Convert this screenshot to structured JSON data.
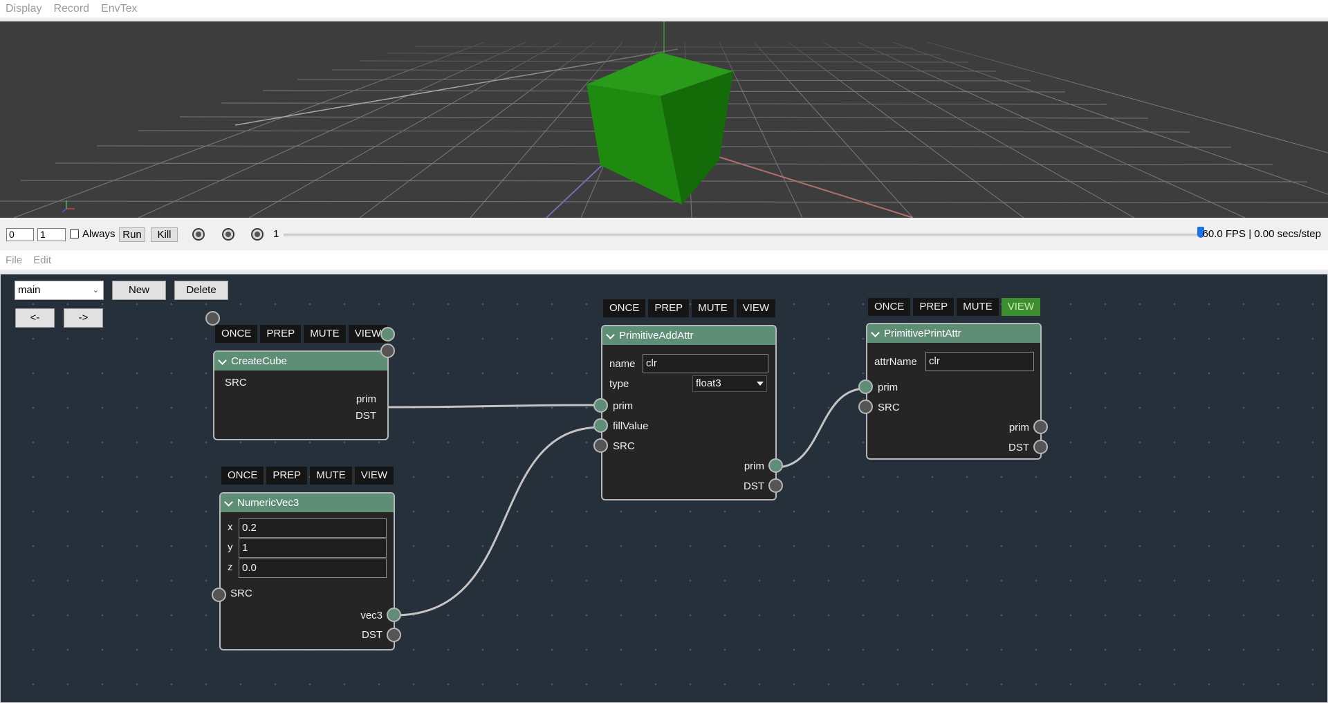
{
  "menubar": {
    "items": [
      "Display",
      "Record",
      "EnvTex"
    ]
  },
  "timeline": {
    "start_frame": "0",
    "end_frame": "1",
    "always_label": "Always",
    "always_checked": false,
    "run_label": "Run",
    "kill_label": "Kill",
    "current_frame": "1",
    "slider_value": 1,
    "fps": "60.0 FPS | 0.00 secs/step"
  },
  "editor_menu": {
    "items": [
      "File",
      "Edit"
    ]
  },
  "graph_toolbar": {
    "graph_select": "main",
    "new_label": "New",
    "delete_label": "Delete",
    "back_label": "<-",
    "forward_label": "->"
  },
  "node_toggles": [
    "ONCE",
    "PREP",
    "MUTE",
    "VIEW"
  ],
  "colors": {
    "header": "#5f8e76",
    "view_active": "#3d8e30",
    "canvas": "#25303a",
    "cube": "#1f8a10"
  },
  "nodes": {
    "create_cube": {
      "title": "CreateCube",
      "inputs": [
        "SRC"
      ],
      "outputs": [
        "prim",
        "DST"
      ],
      "view_active": false
    },
    "numeric_vec3": {
      "title": "NumericVec3",
      "fields": [
        {
          "label": "x",
          "value": "0.2"
        },
        {
          "label": "y",
          "value": "1"
        },
        {
          "label": "z",
          "value": "0.0"
        }
      ],
      "inputs": [
        "SRC"
      ],
      "outputs": [
        "vec3",
        "DST"
      ],
      "view_active": false
    },
    "primitive_add_attr": {
      "title": "PrimitiveAddAttr",
      "name_label": "name",
      "name_value": "clr",
      "type_label": "type",
      "type_value": "float3",
      "inputs": [
        "prim",
        "fillValue",
        "SRC"
      ],
      "outputs": [
        "prim",
        "DST"
      ],
      "view_active": false
    },
    "primitive_print_attr": {
      "title": "PrimitivePrintAttr",
      "attr_label": "attrName",
      "attr_value": "clr",
      "inputs": [
        "prim",
        "SRC"
      ],
      "outputs": [
        "prim",
        "DST"
      ],
      "view_active": true
    }
  }
}
